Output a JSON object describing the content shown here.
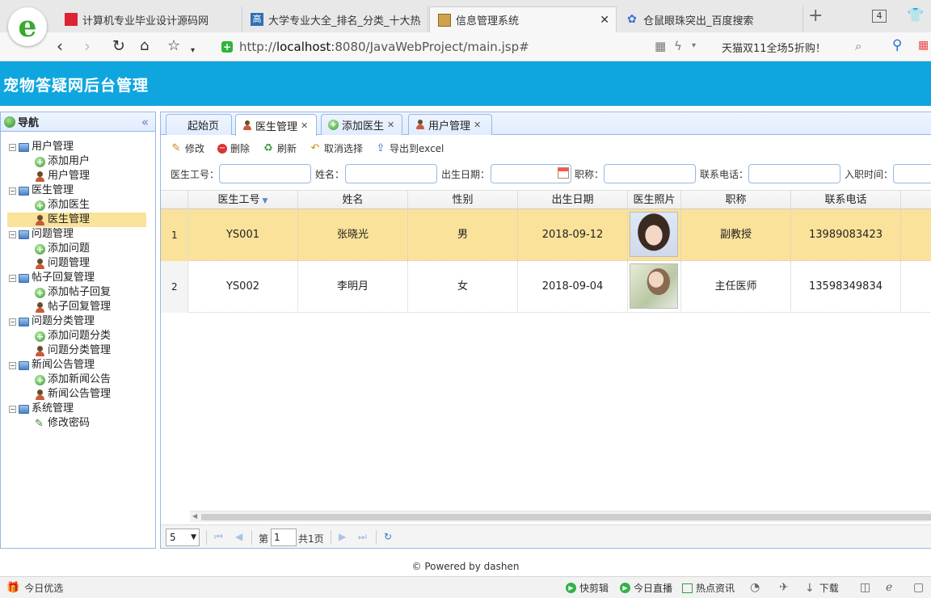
{
  "browser": {
    "logo": "e",
    "tabs": [
      {
        "title": "计算机专业毕业设计源码网",
        "favicon": "red-square"
      },
      {
        "title": "大学专业大全_排名_分类_十大热",
        "favicon": "高"
      },
      {
        "title": "信息管理系统",
        "favicon": "page-icon",
        "active": true
      },
      {
        "title": "仓鼠眼珠突出_百度搜索",
        "favicon": "paw-icon"
      }
    ],
    "tab_count": "4",
    "url_prefix": "http://",
    "url_host": "localhost",
    "url_rest": ":8080/JavaWebProject/main.jsp#",
    "promo": "天猫双11全场5折购！"
  },
  "app": {
    "title": "宠物答疑网后台管理",
    "header_color": "#0fa6e0"
  },
  "nav": {
    "title": "导航",
    "collapse_glyph": "«",
    "groups": [
      {
        "label": "用户管理",
        "items": [
          {
            "label": "添加用户",
            "icon": "add"
          },
          {
            "label": "用户管理",
            "icon": "user"
          }
        ]
      },
      {
        "label": "医生管理",
        "items": [
          {
            "label": "添加医生",
            "icon": "add"
          },
          {
            "label": "医生管理",
            "icon": "user",
            "selected": true
          }
        ]
      },
      {
        "label": "问题管理",
        "items": [
          {
            "label": "添加问题",
            "icon": "add"
          },
          {
            "label": "问题管理",
            "icon": "user"
          }
        ]
      },
      {
        "label": "帖子回复管理",
        "items": [
          {
            "label": "添加帖子回复",
            "icon": "add"
          },
          {
            "label": "帖子回复管理",
            "icon": "user"
          }
        ]
      },
      {
        "label": "问题分类管理",
        "items": [
          {
            "label": "添加问题分类",
            "icon": "add"
          },
          {
            "label": "问题分类管理",
            "icon": "user"
          }
        ]
      },
      {
        "label": "新闻公告管理",
        "items": [
          {
            "label": "添加新闻公告",
            "icon": "add"
          },
          {
            "label": "新闻公告管理",
            "icon": "user"
          }
        ]
      },
      {
        "label": "系统管理",
        "items": [
          {
            "label": "修改密码",
            "icon": "pencil"
          }
        ]
      }
    ]
  },
  "tabs": [
    {
      "label": "起始页",
      "closable": false
    },
    {
      "label": "医生管理",
      "closable": true,
      "active": true,
      "icon": "user"
    },
    {
      "label": "添加医生",
      "closable": true,
      "icon": "add"
    },
    {
      "label": "用户管理",
      "closable": true,
      "icon": "user"
    }
  ],
  "toolbar": {
    "edit": "修改",
    "delete": "删除",
    "refresh": "刷新",
    "unselect": "取消选择",
    "export": "导出到excel"
  },
  "search": {
    "doctor_no": "医生工号：",
    "name": "姓名：",
    "birth_date": "出生日期：",
    "title": "职称：",
    "phone": "联系电话：",
    "hire_date": "入职时间："
  },
  "grid": {
    "columns": [
      "医生工号",
      "姓名",
      "性别",
      "出生日期",
      "医生照片",
      "职称",
      "联系电话"
    ],
    "rows": [
      {
        "num": "1",
        "doctor_no": "YS001",
        "name": "张晓光",
        "gender": "男",
        "birth": "2018-09-12",
        "title": "副教授",
        "phone": "13989083423",
        "selected": true
      },
      {
        "num": "2",
        "doctor_no": "YS002",
        "name": "李明月",
        "gender": "女",
        "birth": "2018-09-04",
        "title": "主任医师",
        "phone": "13598349834"
      }
    ]
  },
  "pager": {
    "page_size": "5",
    "page_prefix": "第",
    "page_value": "1",
    "page_suffix": "共1页"
  },
  "footer": "© Powered by dashen",
  "statusbar": {
    "left": "今日优选",
    "items": [
      "快剪辑",
      "今日直播",
      "热点资讯",
      "下载"
    ]
  }
}
